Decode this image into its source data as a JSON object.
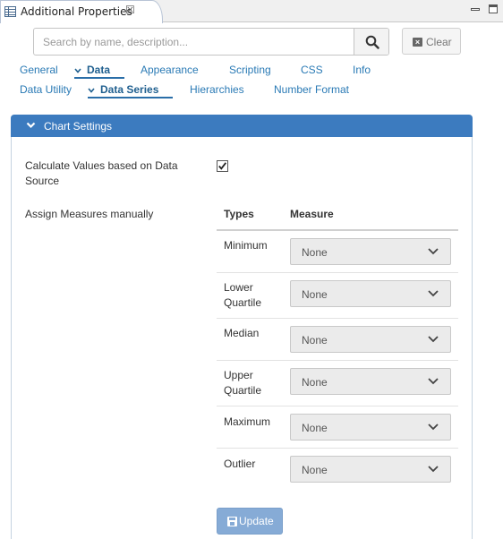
{
  "view": {
    "title": "Additional Properties",
    "close_glyph": "☒",
    "icon": "properties-view-icon"
  },
  "search": {
    "placeholder": "Search by name, description...",
    "value": "",
    "button_icon": "search-icon"
  },
  "clear": {
    "label": "Clear",
    "icon": "clear-icon"
  },
  "tabs_row1": [
    {
      "label": "General",
      "active": false
    },
    {
      "label": "Data",
      "active": true,
      "expanded": true
    },
    {
      "label": "Appearance",
      "active": false
    },
    {
      "label": "Scripting",
      "active": false
    },
    {
      "label": "CSS",
      "active": false
    },
    {
      "label": "Info",
      "active": false
    }
  ],
  "tabs_row2": [
    {
      "label": "Data Utility",
      "active": false
    },
    {
      "label": "Data Series",
      "active": true,
      "expanded": true
    },
    {
      "label": "Hierarchies",
      "active": false
    },
    {
      "label": "Number Format",
      "active": false
    }
  ],
  "panel": {
    "title": "Chart Settings",
    "calculate_label_line1": "Calculate Values based on Data",
    "calculate_label_line2": "Source",
    "calculate_checked": true,
    "assign_label": "Assign Measures manually",
    "table": {
      "headers": [
        "Types",
        "Measure"
      ],
      "rows": [
        {
          "type_line1": "Minimum",
          "type_line2": "",
          "measure": "None"
        },
        {
          "type_line1": "Lower",
          "type_line2": "Quartile",
          "measure": "None"
        },
        {
          "type_line1": "Median",
          "type_line2": "",
          "measure": "None"
        },
        {
          "type_line1": "Upper",
          "type_line2": "Quartile",
          "measure": "None"
        },
        {
          "type_line1": "Maximum",
          "type_line2": "",
          "measure": "None"
        },
        {
          "type_line1": "Outlier",
          "type_line2": "",
          "measure": "None"
        }
      ]
    },
    "update_label": "Update",
    "update_icon": "save-icon"
  },
  "colors": {
    "accent": "#3c7bbf",
    "tab_text": "#2a7ab5",
    "tab_active": "#1f5f8f",
    "update_button": "#86abd6"
  }
}
